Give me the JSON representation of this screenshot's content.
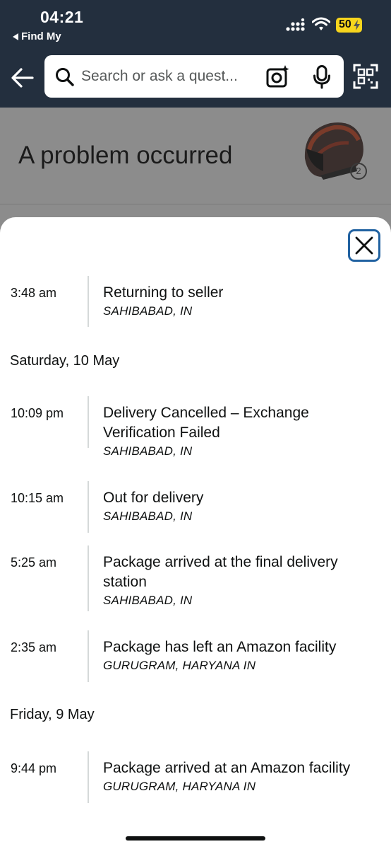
{
  "status_bar": {
    "time": "04:21",
    "back_app_label": "Find My",
    "battery": "50"
  },
  "header": {
    "search_placeholder": "Search or ask a quest...",
    "icons": [
      "back-arrow-icon",
      "search-icon",
      "camera-icon",
      "microphone-icon",
      "qr-scanner-icon"
    ]
  },
  "background_page": {
    "title": "A problem occurred",
    "item_count_badge": "2"
  },
  "sheet": {
    "close_icon": "close-icon",
    "groups": [
      {
        "date": "",
        "events": [
          {
            "time": "3:48 am",
            "title_lines": [
              "Returning to seller"
            ],
            "location": "SAHIBABAD, IN"
          }
        ]
      },
      {
        "date": "Saturday, 10 May",
        "events": [
          {
            "time": "10:09 pm",
            "title_lines": [
              "Delivery Cancelled – Exchange",
              "Verification Failed"
            ],
            "location": "SAHIBABAD, IN"
          },
          {
            "time": "10:15 am",
            "title_lines": [
              "Out for delivery"
            ],
            "location": "SAHIBABAD, IN"
          },
          {
            "time": "5:25 am",
            "title_lines": [
              "Package arrived at the final delivery",
              "station"
            ],
            "location": "SAHIBABAD, IN"
          },
          {
            "time": "2:35 am",
            "title_lines": [
              "Package has left an Amazon facility"
            ],
            "location": "GURUGRAM, HARYANA IN"
          }
        ]
      },
      {
        "date": "Friday, 9 May",
        "events": [
          {
            "time": "9:44 pm",
            "title_lines": [
              "Package arrived at an Amazon facility"
            ],
            "location": "GURUGRAM, HARYANA IN"
          }
        ]
      }
    ]
  }
}
